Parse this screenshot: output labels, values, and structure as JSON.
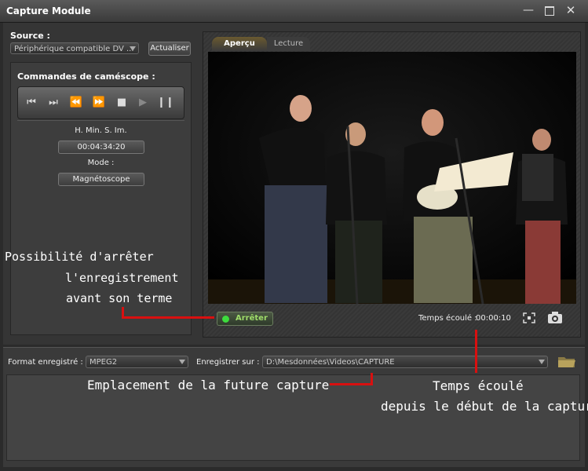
{
  "window": {
    "title": "Capture Module",
    "controls": [
      "minimize",
      "maximize",
      "close"
    ]
  },
  "source": {
    "label": "Source :",
    "value": "Périphérique compatible DV ...",
    "refresh_label": "Actualiser"
  },
  "camcorder": {
    "label": "Commandes de caméscope :",
    "transport": [
      "skip-back-icon",
      "skip-forward-icon",
      "rewind-icon",
      "fast-forward-icon",
      "stop-icon",
      "play-icon",
      "pause-icon"
    ],
    "time_label": "H. Min. S. Im.",
    "time_value": "00:04:34:20",
    "mode_label": "Mode :",
    "mode_value": "Magnétoscope"
  },
  "preview": {
    "tabs": [
      "Aperçu",
      "Lecture"
    ],
    "active_tab": "Aperçu",
    "stop_label": "Arrêter",
    "elapsed_label": "Temps écoulé :",
    "elapsed_value": "00:00:10"
  },
  "bottom": {
    "format_label": "Format enregistré :",
    "format_value": "MPEG2",
    "save_label": "Enregistrer sur :",
    "save_path": "D:\\Mesdonnées\\Videos\\CAPTURE"
  },
  "annotations": {
    "stop_line1": "Possibilité d'arrêter",
    "stop_line2": "l'enregistrement",
    "stop_line3": "avant son terme",
    "location": "Emplacement de la future capture",
    "elapsed_line1": "Temps écoulé",
    "elapsed_line2": "depuis le début de la capture"
  },
  "colors": {
    "annotation_red": "#d81010",
    "record_green": "#3ddc3d",
    "stop_text": "#9fdc6a"
  }
}
